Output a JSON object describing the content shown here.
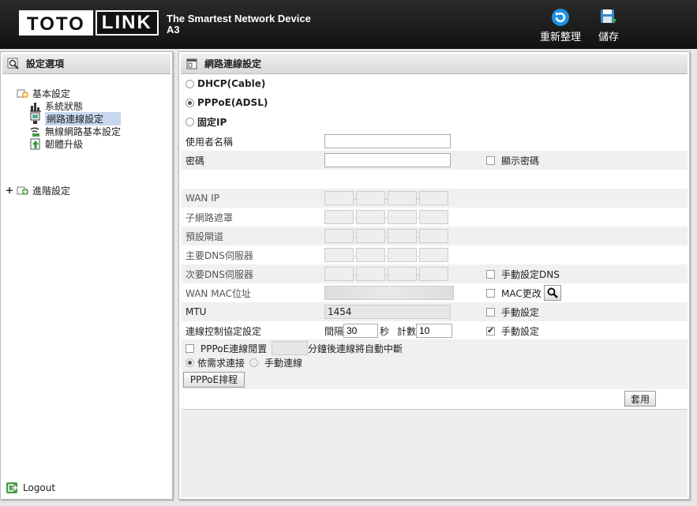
{
  "header": {
    "logo_left": "TOTO",
    "logo_right": "LINK",
    "tagline_line1": "The Smartest Network Device",
    "tagline_line2": "A3",
    "reboot_label": "重新整理",
    "save_label": "儲存"
  },
  "sidebar": {
    "title": "設定選項",
    "basic_label": "基本設定",
    "items": [
      {
        "label": "系統狀態"
      },
      {
        "label": "網路連線設定"
      },
      {
        "label": "無線網路基本設定"
      },
      {
        "label": "韌體升級"
      }
    ],
    "advanced_label": "進階設定",
    "logout_label": "Logout"
  },
  "main": {
    "title": "網路連線設定",
    "modes": [
      {
        "label": "DHCP(Cable)",
        "selected": false
      },
      {
        "label": "PPPoE(ADSL)",
        "selected": true
      },
      {
        "label": "固定IP",
        "selected": false
      }
    ],
    "username_label": "使用者名稱",
    "username_value": "",
    "password_label": "密碼",
    "password_value": "",
    "show_password_label": "顯示密碼",
    "wan_ip_label": "WAN IP",
    "subnet_label": "子網路遮罩",
    "gateway_label": "預設閘道",
    "dns1_label": "主要DNS伺服器",
    "dns2_label": "次要DNS伺服器",
    "manual_dns_label": "手動設定DNS",
    "wan_mac_label": "WAN MAC位址",
    "mac_change_label": "MAC更改",
    "mtu_label": "MTU",
    "mtu_value": "1454",
    "mtu_manual_label": "手動設定",
    "lcp_label": "連線控制協定設定",
    "interval_label": "間隔",
    "interval_value": "30",
    "seconds_label": "秒",
    "count_label": "計數",
    "count_value": "10",
    "lcp_manual_label": "手動設定",
    "idle_label": "PPPoE連線閒置",
    "idle_value": "",
    "idle_suffix": "分鐘後連線將自動中斷",
    "on_demand_label": "依需求連接",
    "manual_connect_label": "手動連線",
    "schedule_button": "PPPoE排程",
    "apply_button": "套用"
  },
  "colors": {
    "header_bg": "#1a1a1a",
    "selected_bg": "#c6d7ee",
    "alt_row": "#f0f0f0"
  }
}
